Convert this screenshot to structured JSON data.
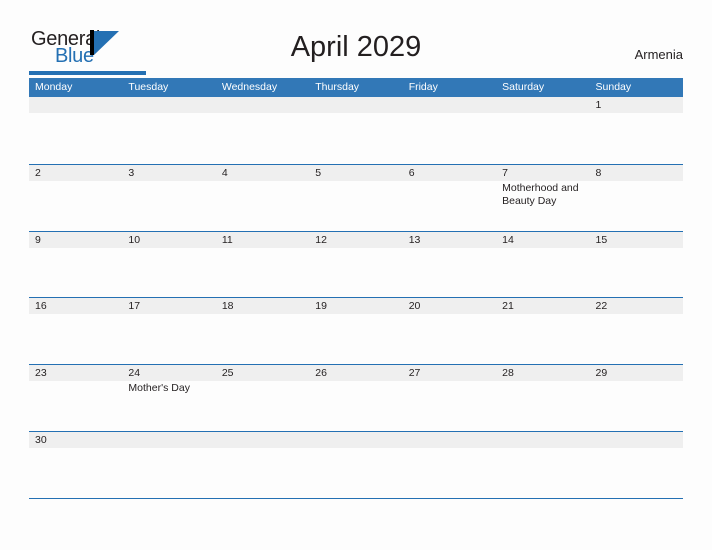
{
  "brand": {
    "word_one": "General",
    "word_two": "Blue",
    "mark_icon": "general-blue-triangle-icon",
    "accent_color": "#2470b3"
  },
  "header": {
    "title": "April 2029",
    "country": "Armenia"
  },
  "colors": {
    "header_blue": "#3278b7",
    "rule_blue": "#2470b3",
    "daynum_band": "#efefef",
    "text": "#231f20",
    "page_background": "#fdfdfd"
  },
  "calendar": {
    "weekdays": [
      "Monday",
      "Tuesday",
      "Wednesday",
      "Thursday",
      "Friday",
      "Saturday",
      "Sunday"
    ],
    "weeks": [
      [
        {
          "day": ""
        },
        {
          "day": ""
        },
        {
          "day": ""
        },
        {
          "day": ""
        },
        {
          "day": ""
        },
        {
          "day": ""
        },
        {
          "day": "1"
        }
      ],
      [
        {
          "day": "2"
        },
        {
          "day": "3"
        },
        {
          "day": "4"
        },
        {
          "day": "5"
        },
        {
          "day": "6"
        },
        {
          "day": "7",
          "event": "Motherhood and Beauty Day"
        },
        {
          "day": "8"
        }
      ],
      [
        {
          "day": "9"
        },
        {
          "day": "10"
        },
        {
          "day": "11"
        },
        {
          "day": "12"
        },
        {
          "day": "13"
        },
        {
          "day": "14"
        },
        {
          "day": "15"
        }
      ],
      [
        {
          "day": "16"
        },
        {
          "day": "17"
        },
        {
          "day": "18"
        },
        {
          "day": "19"
        },
        {
          "day": "20"
        },
        {
          "day": "21"
        },
        {
          "day": "22"
        }
      ],
      [
        {
          "day": "23"
        },
        {
          "day": "24",
          "event": "Mother's Day"
        },
        {
          "day": "25"
        },
        {
          "day": "26"
        },
        {
          "day": "27"
        },
        {
          "day": "28"
        },
        {
          "day": "29"
        }
      ],
      [
        {
          "day": "30"
        },
        {
          "day": ""
        },
        {
          "day": ""
        },
        {
          "day": ""
        },
        {
          "day": ""
        },
        {
          "day": ""
        },
        {
          "day": ""
        }
      ]
    ]
  }
}
